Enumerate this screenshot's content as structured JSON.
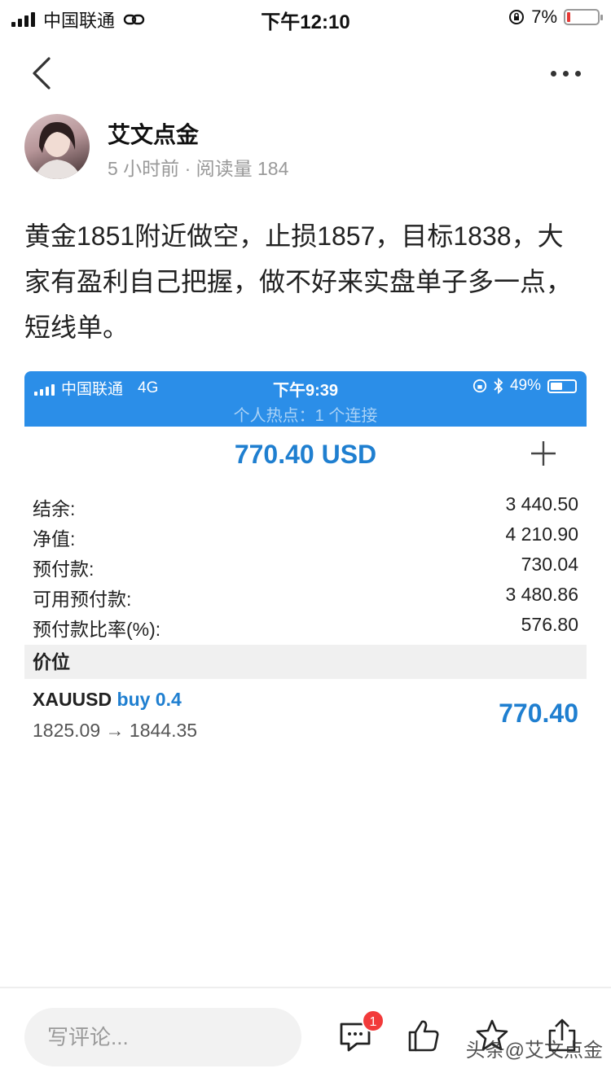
{
  "status_bar": {
    "carrier": "中国联通",
    "time": "下午12:10",
    "battery_pct": "7%"
  },
  "author": {
    "name": "艾文点金",
    "meta": "5 小时前 · 阅读量 184"
  },
  "post": {
    "text": "黄金1851附近做空，止损1857，目标1838，大家有盈利自己把握，做不好来实盘单子多一点，短线单。"
  },
  "screenshot": {
    "status": {
      "carrier": "中国联通",
      "network": "4G",
      "time": "下午9:39",
      "battery_pct": "49%",
      "hotspot": "个人热点：1 个连接"
    },
    "profit_header": "770.40 USD",
    "rows": [
      {
        "label": "结余:",
        "value": "3 440.50"
      },
      {
        "label": "净值:",
        "value": "4 210.90"
      },
      {
        "label": "预付款:",
        "value": "730.04"
      },
      {
        "label": "可用预付款:",
        "value": "3 480.86"
      },
      {
        "label": "预付款比率(%):",
        "value": "576.80"
      }
    ],
    "section_title": "价位",
    "position": {
      "symbol": "XAUUSD",
      "direction": "buy 0.4",
      "prices": "1825.09 → 1844.35",
      "profit": "770.40"
    }
  },
  "bottom_bar": {
    "comment_placeholder": "写评论...",
    "comment_badge": "1",
    "watermark": "头条@艾文点金"
  },
  "colors": {
    "accent_blue": "#1f7fd0",
    "status_bar_blue": "#2b8ee8",
    "badge_red": "#f23a3a"
  }
}
